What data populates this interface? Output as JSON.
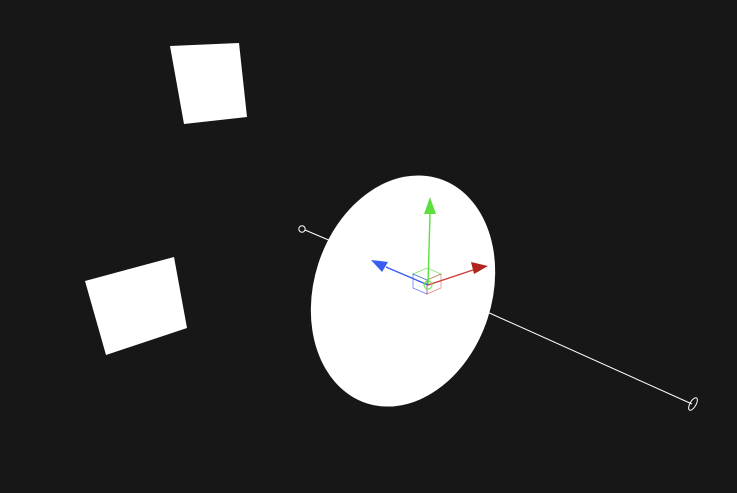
{
  "viewport": {
    "background": "#171717"
  },
  "scene": {
    "objects": [
      {
        "id": "quad-a",
        "kind": "quad",
        "color": "#ffffff",
        "selected": false
      },
      {
        "id": "quad-b",
        "kind": "quad",
        "color": "#ffffff",
        "selected": false
      },
      {
        "id": "disc",
        "kind": "ellipse-plane",
        "color": "#ffffff",
        "selected": true
      },
      {
        "id": "guide-line",
        "kind": "ray-line",
        "color": "#ffffff",
        "selected": false
      }
    ]
  },
  "gizmo": {
    "type": "translate",
    "axes": [
      {
        "axis": "x",
        "color": "#d03a32",
        "icon": "arrow-right-icon"
      },
      {
        "axis": "y",
        "color": "#5ce040",
        "icon": "arrow-up-icon"
      },
      {
        "axis": "z",
        "color": "#3a5cf0",
        "icon": "arrow-left-icon"
      }
    ],
    "center_cube_colors": [
      "#5ce040",
      "#3a5cf0",
      "#d03a32"
    ]
  }
}
